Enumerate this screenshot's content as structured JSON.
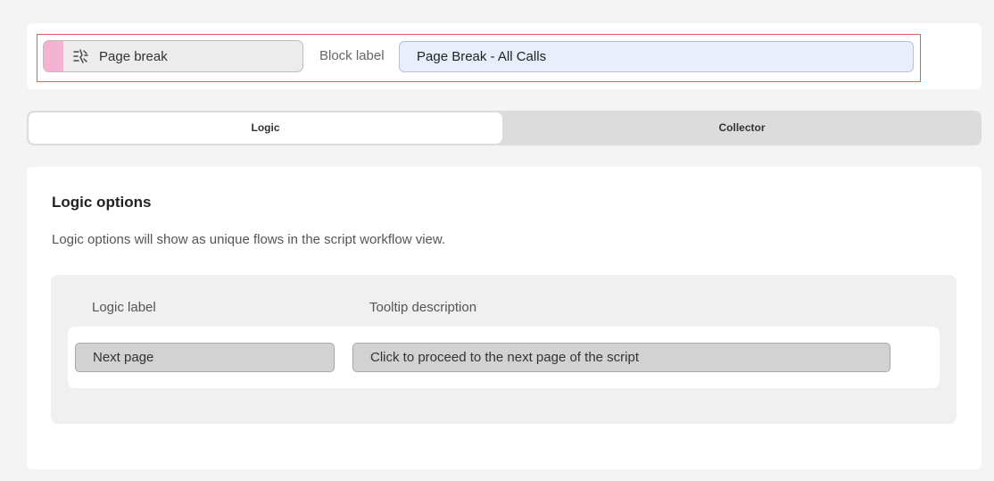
{
  "header": {
    "block_type": {
      "label": "Page break",
      "icon": "page-break-icon",
      "swatch_color": "#f5b3d4"
    },
    "block_label": {
      "caption": "Block label",
      "value": "Page Break - All Calls"
    },
    "highlight_color": "#e35d5d"
  },
  "tabs": [
    {
      "label": "Logic",
      "active": true
    },
    {
      "label": "Collector",
      "active": false
    }
  ],
  "logic_options": {
    "title": "Logic options",
    "description": "Logic options will show as unique flows in the script workflow view.",
    "columns": {
      "label": "Logic label",
      "tooltip": "Tooltip description"
    },
    "rows": [
      {
        "label": "Next page",
        "tooltip": "Click to proceed to the next page of the script"
      }
    ]
  }
}
